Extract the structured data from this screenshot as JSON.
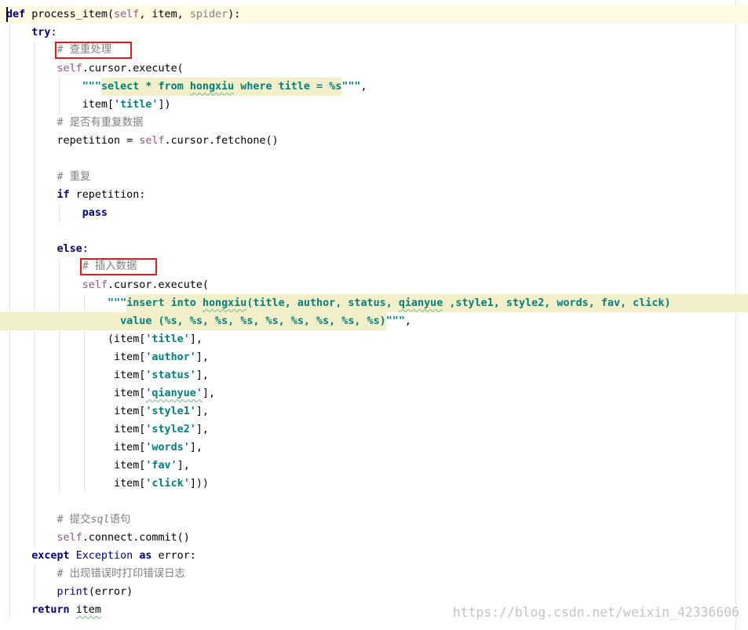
{
  "theme": {
    "keyword": "#000080",
    "self": "#94558D",
    "string": "#008080",
    "comment": "#808080",
    "builtin": "#000080",
    "unused": "#808080",
    "plain": "#000000",
    "injection": "#f3efc8",
    "caret_line": "#fffae3",
    "annotation": "#e8191d"
  },
  "editor": {
    "language": "python",
    "caret_line": 1,
    "lines": [
      {
        "indent": 0,
        "tokens": [
          {
            "type": "keyword",
            "text": "def"
          },
          {
            "type": "plain",
            "text": " "
          },
          {
            "type": "fn",
            "text": "process_item"
          },
          {
            "type": "plain",
            "text": "("
          },
          {
            "type": "self",
            "text": "self"
          },
          {
            "type": "plain",
            "text": ", item, "
          },
          {
            "type": "unused",
            "text": "spider"
          },
          {
            "type": "plain",
            "text": "):"
          }
        ]
      },
      {
        "indent": 4,
        "tokens": [
          {
            "type": "keyword",
            "text": "try"
          },
          {
            "type": "plain",
            "text": ":"
          }
        ]
      },
      {
        "indent": 8,
        "tokens": [
          {
            "type": "comment",
            "text": "# 查重处理",
            "boxed": true
          }
        ]
      },
      {
        "indent": 8,
        "tokens": [
          {
            "type": "self",
            "text": "self"
          },
          {
            "type": "plain",
            "text": ".cursor.execute("
          }
        ]
      },
      {
        "indent": 12,
        "tokens": [
          {
            "type": "string",
            "text": "\"\"\""
          },
          {
            "type": "string",
            "text": "select * from ",
            "inj": true
          },
          {
            "type": "string",
            "text": "hongxiu",
            "inj": true,
            "typo": true
          },
          {
            "type": "string",
            "text": " where title = %s",
            "inj": true
          },
          {
            "type": "string",
            "text": "\"\"\""
          },
          {
            "type": "plain",
            "text": ","
          }
        ]
      },
      {
        "indent": 12,
        "tokens": [
          {
            "type": "plain",
            "text": "item["
          },
          {
            "type": "string",
            "text": "'title'"
          },
          {
            "type": "plain",
            "text": "])"
          }
        ]
      },
      {
        "indent": 8,
        "tokens": [
          {
            "type": "comment",
            "text": "# 是否有重复数据"
          }
        ]
      },
      {
        "indent": 8,
        "tokens": [
          {
            "type": "plain",
            "text": "repetition = "
          },
          {
            "type": "self",
            "text": "self"
          },
          {
            "type": "plain",
            "text": ".cursor.fetchone()"
          }
        ]
      },
      {
        "indent": 0,
        "tokens": []
      },
      {
        "indent": 8,
        "tokens": [
          {
            "type": "comment",
            "text": "# 重复"
          }
        ]
      },
      {
        "indent": 8,
        "tokens": [
          {
            "type": "keyword",
            "text": "if"
          },
          {
            "type": "plain",
            "text": " repetition:"
          }
        ]
      },
      {
        "indent": 12,
        "tokens": [
          {
            "type": "keyword",
            "text": "pass"
          }
        ]
      },
      {
        "indent": 0,
        "tokens": []
      },
      {
        "indent": 8,
        "tokens": [
          {
            "type": "keyword",
            "text": "else"
          },
          {
            "type": "plain",
            "text": ":"
          }
        ]
      },
      {
        "indent": 12,
        "tokens": [
          {
            "type": "comment",
            "text": "# 插入数据",
            "boxed": true
          }
        ]
      },
      {
        "indent": 12,
        "tokens": [
          {
            "type": "self",
            "text": "self"
          },
          {
            "type": "plain",
            "text": ".cursor.execute("
          }
        ]
      },
      {
        "indent": 16,
        "tokens": [
          {
            "type": "string",
            "text": "\"\"\""
          },
          {
            "type": "string",
            "text": "insert into ",
            "inj": true
          },
          {
            "type": "string",
            "text": "hongxiu",
            "inj": true,
            "typo": true
          },
          {
            "type": "string",
            "text": "(title, author, status, ",
            "inj": true
          },
          {
            "type": "string",
            "text": "qianyue",
            "inj": true,
            "typo": true
          },
          {
            "type": "string",
            "text": " ,style1, style2, words, fav, click)",
            "inj": true
          }
        ]
      },
      {
        "indent": 0,
        "tokens": [
          {
            "type": "string",
            "text": "                  value (%s, %s, %s, %s, %s, %s, %s, %s, %s)",
            "inj": true
          },
          {
            "type": "string",
            "text": "\"\"\""
          },
          {
            "type": "plain",
            "text": ","
          }
        ]
      },
      {
        "indent": 16,
        "tokens": [
          {
            "type": "plain",
            "text": "(item["
          },
          {
            "type": "string",
            "text": "'title'"
          },
          {
            "type": "plain",
            "text": "],"
          }
        ]
      },
      {
        "indent": 17,
        "tokens": [
          {
            "type": "plain",
            "text": "item["
          },
          {
            "type": "string",
            "text": "'author'"
          },
          {
            "type": "plain",
            "text": "],"
          }
        ]
      },
      {
        "indent": 17,
        "tokens": [
          {
            "type": "plain",
            "text": "item["
          },
          {
            "type": "string",
            "text": "'status'"
          },
          {
            "type": "plain",
            "text": "],"
          }
        ]
      },
      {
        "indent": 17,
        "tokens": [
          {
            "type": "plain",
            "text": "item["
          },
          {
            "type": "string",
            "text": "'qianyue'",
            "typo": true
          },
          {
            "type": "plain",
            "text": "],"
          }
        ]
      },
      {
        "indent": 17,
        "tokens": [
          {
            "type": "plain",
            "text": "item["
          },
          {
            "type": "string",
            "text": "'style1'"
          },
          {
            "type": "plain",
            "text": "],"
          }
        ]
      },
      {
        "indent": 17,
        "tokens": [
          {
            "type": "plain",
            "text": "item["
          },
          {
            "type": "string",
            "text": "'style2'"
          },
          {
            "type": "plain",
            "text": "],"
          }
        ]
      },
      {
        "indent": 17,
        "tokens": [
          {
            "type": "plain",
            "text": "item["
          },
          {
            "type": "string",
            "text": "'words'"
          },
          {
            "type": "plain",
            "text": "],"
          }
        ]
      },
      {
        "indent": 17,
        "tokens": [
          {
            "type": "plain",
            "text": "item["
          },
          {
            "type": "string",
            "text": "'fav'"
          },
          {
            "type": "plain",
            "text": "],"
          }
        ]
      },
      {
        "indent": 17,
        "tokens": [
          {
            "type": "plain",
            "text": "item["
          },
          {
            "type": "string",
            "text": "'click'"
          },
          {
            "type": "plain",
            "text": "]))"
          }
        ]
      },
      {
        "indent": 0,
        "tokens": []
      },
      {
        "indent": 8,
        "tokens": [
          {
            "type": "comment",
            "text": "# 提交"
          },
          {
            "type": "comment",
            "text": "sql",
            "italic": true
          },
          {
            "type": "comment",
            "text": "语句"
          }
        ]
      },
      {
        "indent": 8,
        "tokens": [
          {
            "type": "self",
            "text": "self"
          },
          {
            "type": "plain",
            "text": ".connect.commit()"
          }
        ]
      },
      {
        "indent": 4,
        "tokens": [
          {
            "type": "keyword",
            "text": "except"
          },
          {
            "type": "plain",
            "text": " "
          },
          {
            "type": "builtin",
            "text": "Exception"
          },
          {
            "type": "plain",
            "text": " "
          },
          {
            "type": "keyword",
            "text": "as"
          },
          {
            "type": "plain",
            "text": " error:"
          }
        ]
      },
      {
        "indent": 8,
        "tokens": [
          {
            "type": "comment",
            "text": "# 出现错误时打印错误日志"
          }
        ]
      },
      {
        "indent": 8,
        "tokens": [
          {
            "type": "builtin",
            "text": "print"
          },
          {
            "type": "plain",
            "text": "(error)"
          }
        ]
      },
      {
        "indent": 4,
        "tokens": [
          {
            "type": "keyword",
            "text": "return"
          },
          {
            "type": "plain",
            "text": " "
          },
          {
            "type": "plain",
            "text": "item",
            "typo": true
          }
        ]
      }
    ]
  },
  "watermark": "https://blog.csdn.net/weixin_42336606"
}
